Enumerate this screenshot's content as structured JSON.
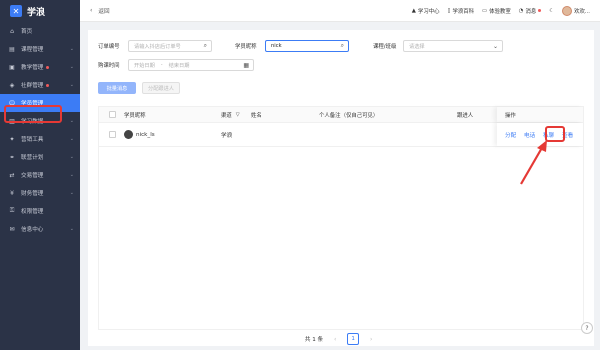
{
  "brand": {
    "logo": "✕",
    "name": "学浪"
  },
  "sidebar": {
    "items": [
      {
        "icon": "home-icon",
        "glyph": "⌂",
        "label": "首页",
        "chevron": false,
        "dot": false,
        "active": false
      },
      {
        "icon": "course-icon",
        "glyph": "▤",
        "label": "课程管理",
        "chevron": true,
        "dot": false,
        "active": false
      },
      {
        "icon": "teach-icon",
        "glyph": "▣",
        "label": "教学管理",
        "chevron": true,
        "dot": true,
        "active": false
      },
      {
        "icon": "community-icon",
        "glyph": "◈",
        "label": "社群管理",
        "chevron": true,
        "dot": true,
        "active": false
      },
      {
        "icon": "student-icon",
        "glyph": "☺",
        "label": "学员管理",
        "chevron": false,
        "dot": false,
        "active": true
      },
      {
        "icon": "data-icon",
        "glyph": "▥",
        "label": "学习数据",
        "chevron": true,
        "dot": false,
        "active": false
      },
      {
        "icon": "marketing-icon",
        "glyph": "✦",
        "label": "营销工具",
        "chevron": true,
        "dot": false,
        "active": false
      },
      {
        "icon": "affiliate-icon",
        "glyph": "⚭",
        "label": "联营计划",
        "chevron": true,
        "dot": false,
        "active": false
      },
      {
        "icon": "trade-icon",
        "glyph": "⇄",
        "label": "交易管理",
        "chevron": true,
        "dot": false,
        "active": false
      },
      {
        "icon": "finance-icon",
        "glyph": "¥",
        "label": "财务管理",
        "chevron": true,
        "dot": false,
        "active": false
      },
      {
        "icon": "permission-icon",
        "glyph": "⚿",
        "label": "权限管理",
        "chevron": false,
        "dot": false,
        "active": false
      },
      {
        "icon": "message-icon",
        "glyph": "✉",
        "label": "信息中心",
        "chevron": true,
        "dot": false,
        "active": false
      }
    ]
  },
  "topbar": {
    "back_label": "返回",
    "links": [
      {
        "icon": "graduation-icon",
        "glyph": "🎓",
        "label": "学习中心"
      },
      {
        "icon": "book-icon",
        "glyph": "▯",
        "label": "学浪百科"
      },
      {
        "icon": "monitor-icon",
        "glyph": "▭",
        "label": "体验教室"
      },
      {
        "icon": "bell-icon",
        "glyph": "🔔",
        "label": "消息"
      }
    ],
    "user_name": "欢欢..."
  },
  "filters": {
    "order_label": "订单编号",
    "order_placeholder": "请输入抖店后订单号",
    "nickname_label": "学员昵称",
    "nickname_value": "nick",
    "course_label": "课程/班级",
    "course_placeholder": "请选择",
    "time_label": "购课时间",
    "start_placeholder": "开始日期",
    "end_placeholder": "结束日期",
    "separator": "-"
  },
  "actions": {
    "primary": "批量消息",
    "secondary": "分配跟进人"
  },
  "table": {
    "headers": {
      "nickname": "学员昵称",
      "channel": "渠道",
      "name": "姓名",
      "remark": "个人备注（仅自己可见）",
      "follower": "跟进人",
      "ops": "操作"
    },
    "rows": [
      {
        "nickname": "nick_ls",
        "channel": "学浪",
        "name": "",
        "remark": "",
        "follower": "",
        "ops": [
          "分配",
          "电话",
          "私聊",
          "查看"
        ]
      }
    ]
  },
  "pager": {
    "total": "共 1 条",
    "current": "1"
  },
  "help": "?"
}
